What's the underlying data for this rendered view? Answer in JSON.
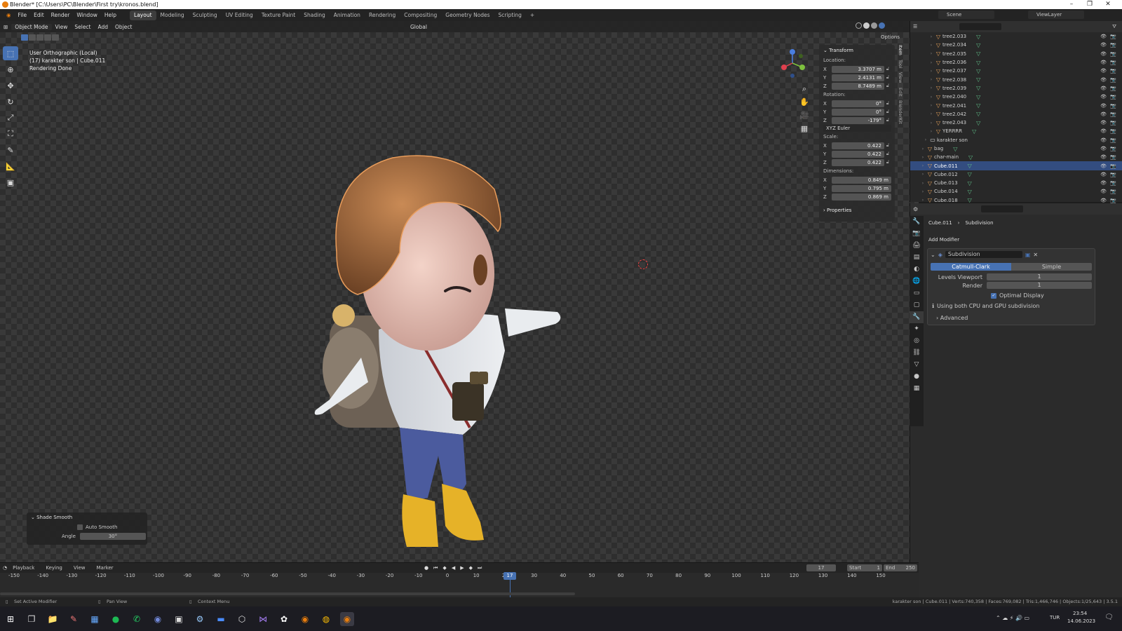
{
  "window": {
    "title": "Blender* [C:\\Users\\PC\\Blender\\First try\\kronos.blend]"
  },
  "menu": [
    "File",
    "Edit",
    "Render",
    "Window",
    "Help"
  ],
  "workspaces": [
    "Layout",
    "Modeling",
    "Sculpting",
    "UV Editing",
    "Texture Paint",
    "Shading",
    "Animation",
    "Rendering",
    "Compositing",
    "Geometry Nodes",
    "Scripting"
  ],
  "active_workspace": "Layout",
  "top_right": {
    "scene": "Scene",
    "viewlayer": "ViewLayer"
  },
  "viewport": {
    "mode": "Object Mode",
    "menus": [
      "View",
      "Select",
      "Add",
      "Object"
    ],
    "transform_orientation": "Global",
    "options_label": "Options",
    "info_lines": [
      "User Orthographic (Local)",
      "(17) karakter son | Cube.011",
      "Rendering Done"
    ]
  },
  "npanel": {
    "header": "Transform",
    "location_label": "Location:",
    "location": [
      "3.3707 m",
      "2.4131 m",
      "8.7489 m"
    ],
    "rotation_label": "Rotation:",
    "rotation": [
      "0°",
      "0°",
      "-179°"
    ],
    "rotation_mode": "XYZ Euler",
    "scale_label": "Scale:",
    "scale": [
      "0.422",
      "0.422",
      "0.422"
    ],
    "dimensions_label": "Dimensions:",
    "dimensions": [
      "0.849 m",
      "0.795 m",
      "0.869 m"
    ],
    "properties_label": "Properties",
    "axes": [
      "X",
      "Y",
      "Z"
    ],
    "side_tabs": [
      "Item",
      "Tool",
      "View",
      "Edit",
      "BlenderKit"
    ]
  },
  "last_operator": {
    "title": "Shade Smooth",
    "auto_smooth_label": "Auto Smooth",
    "angle_label": "Angle",
    "angle_value": "30°"
  },
  "outliner": {
    "rows": [
      {
        "name": "tree2.033",
        "type": "obj"
      },
      {
        "name": "tree2.034",
        "type": "obj"
      },
      {
        "name": "tree2.035",
        "type": "obj"
      },
      {
        "name": "tree2.036",
        "type": "obj"
      },
      {
        "name": "tree2.037",
        "type": "obj"
      },
      {
        "name": "tree2.038",
        "type": "obj"
      },
      {
        "name": "tree2.039",
        "type": "obj"
      },
      {
        "name": "tree2.040",
        "type": "obj"
      },
      {
        "name": "tree2.041",
        "type": "obj"
      },
      {
        "name": "tree2.042",
        "type": "obj"
      },
      {
        "name": "tree2.043",
        "type": "obj"
      },
      {
        "name": "YERRRR",
        "type": "obj"
      },
      {
        "name": "karakter son",
        "type": "col"
      },
      {
        "name": "bag",
        "type": "obj"
      },
      {
        "name": "char-main",
        "type": "obj"
      },
      {
        "name": "Cube.011",
        "type": "obj",
        "selected": true
      },
      {
        "name": "Cube.012",
        "type": "obj"
      },
      {
        "name": "Cube.013",
        "type": "obj"
      },
      {
        "name": "Cube.014",
        "type": "obj"
      },
      {
        "name": "Cube.018",
        "type": "obj"
      }
    ]
  },
  "properties": {
    "breadcrumb_object": "Cube.011",
    "breadcrumb_modifier": "Subdivision",
    "add_modifier": "Add Modifier",
    "modifier_name": "Subdivision",
    "catmull": "Catmull-Clark",
    "simple": "Simple",
    "levels_viewport_label": "Levels Viewport",
    "levels_viewport": "1",
    "render_label": "Render",
    "render": "1",
    "optimal_display": "Optimal Display",
    "info": "Using both CPU and GPU subdivision",
    "advanced": "Advanced"
  },
  "timeline": {
    "menus": [
      "Playback",
      "Keying",
      "View",
      "Marker"
    ],
    "current_frame": "17",
    "start_label": "Start",
    "start": "1",
    "end_label": "End",
    "end": "250",
    "ticks": [
      "-150",
      "-140",
      "-130",
      "-120",
      "-110",
      "-100",
      "-90",
      "-80",
      "-70",
      "-60",
      "-50",
      "-40",
      "-30",
      "-20",
      "-10",
      "0",
      "10",
      "20",
      "30",
      "40",
      "50",
      "60",
      "70",
      "80",
      "90",
      "100",
      "110",
      "120",
      "130",
      "140",
      "150"
    ],
    "playhead_label": "17"
  },
  "statusbar": {
    "left1": "Set Active Modifier",
    "left2": "Pan View",
    "left3": "Context Menu",
    "right": "karakter son | Cube.011 | Verts:740,358 | Faces:769,082 | Tris:1,466,746 | Objects:1/25,643 | 3.5.1"
  },
  "taskbar": {
    "lang": "TUR",
    "time": "23:54",
    "date": "14.06.2023"
  },
  "colors": {
    "accent": "#4772b3",
    "selected_row": "#334d80",
    "object_orange": "#e6a15a"
  }
}
